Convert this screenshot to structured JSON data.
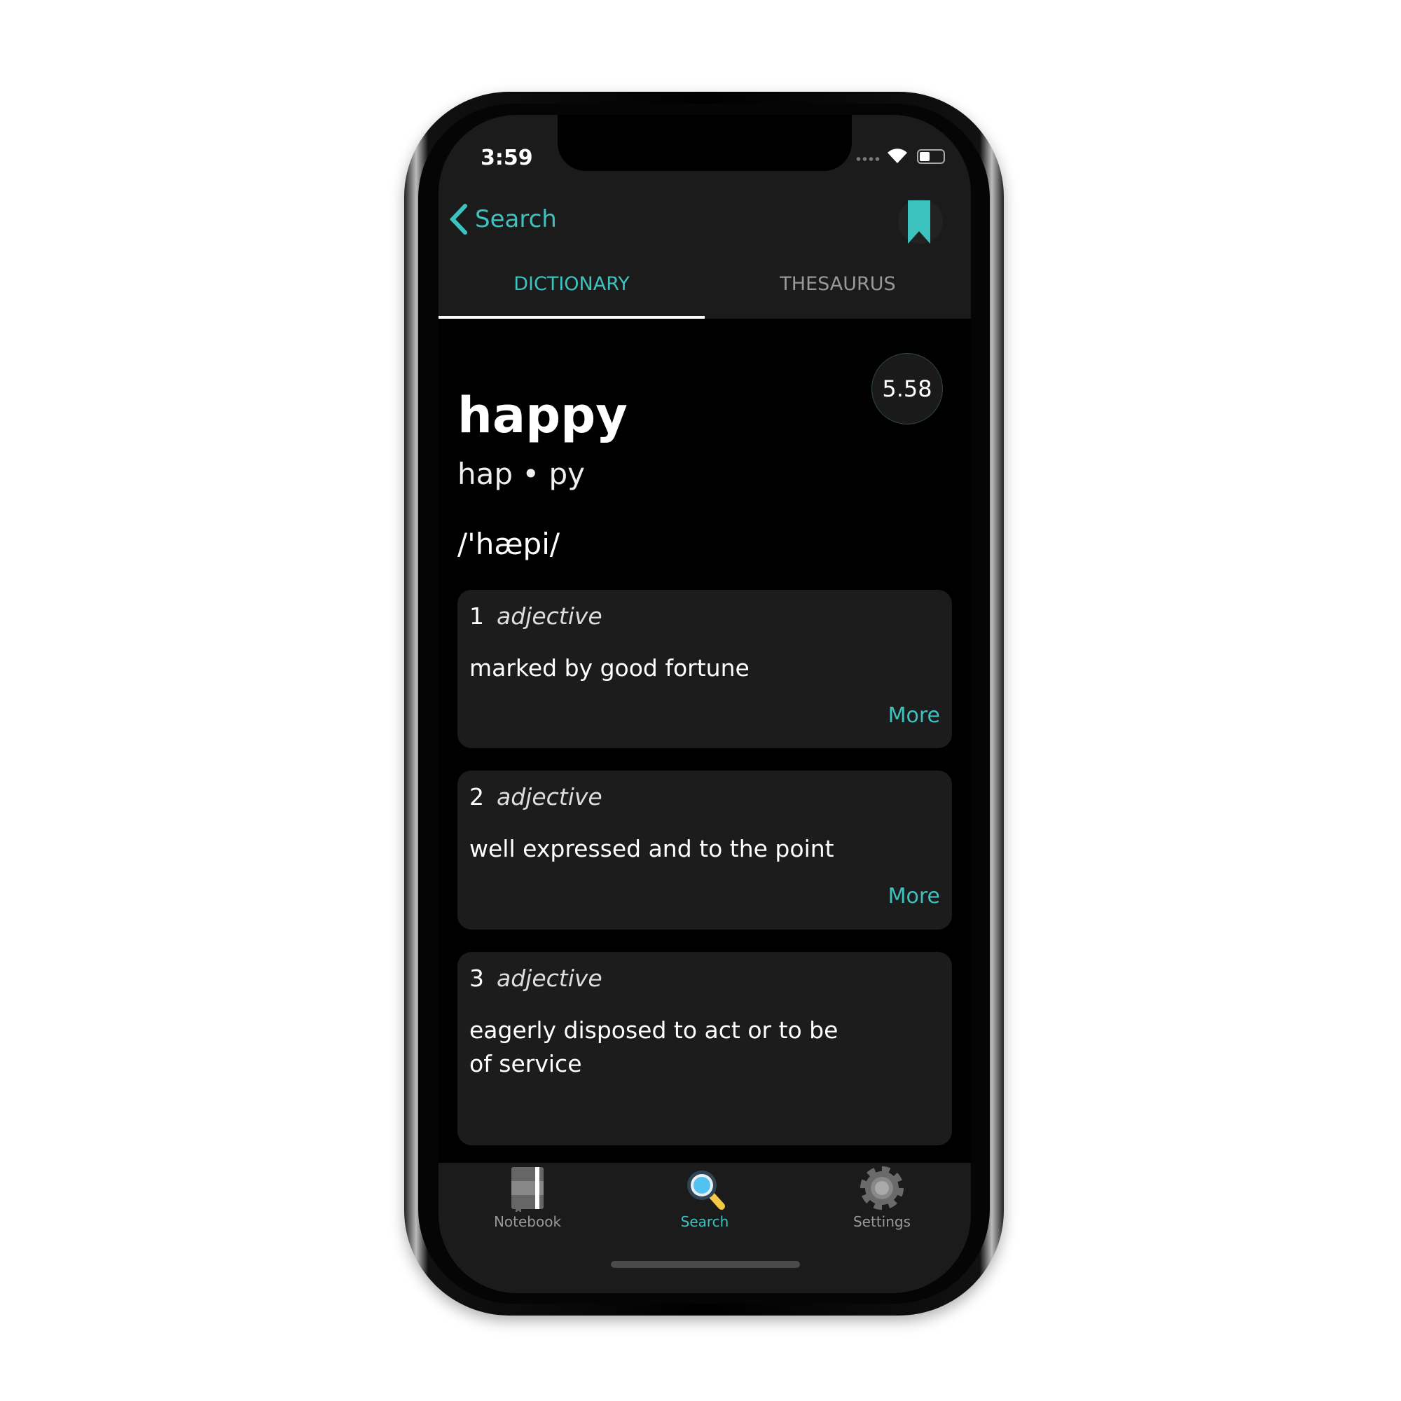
{
  "status": {
    "time": "3:59"
  },
  "nav": {
    "back_label": "Search",
    "bookmark_icon": "bookmark-icon"
  },
  "tabs": [
    {
      "label": "DICTIONARY",
      "active": true
    },
    {
      "label": "THESAURUS",
      "active": false
    }
  ],
  "word": {
    "title": "happy",
    "syllables": "hap • py",
    "pronunciation": "/'hæpi/",
    "score": "5.58"
  },
  "definitions": [
    {
      "number": "1",
      "pos": "adjective",
      "text": "marked by good fortune",
      "more": "More"
    },
    {
      "number": "2",
      "pos": "adjective",
      "text": "well expressed and to the point",
      "more": "More"
    },
    {
      "number": "3",
      "pos": "adjective",
      "text": "eagerly disposed to act or to be of service"
    }
  ],
  "tabbar": [
    {
      "label": "Notebook",
      "icon": "notebook-icon"
    },
    {
      "label": "Search",
      "icon": "search-icon",
      "active": true
    },
    {
      "label": "Settings",
      "icon": "gear-icon"
    }
  ],
  "colors": {
    "accent": "#3cc3c0",
    "background": "#000000",
    "surface": "#1c1c1c"
  }
}
